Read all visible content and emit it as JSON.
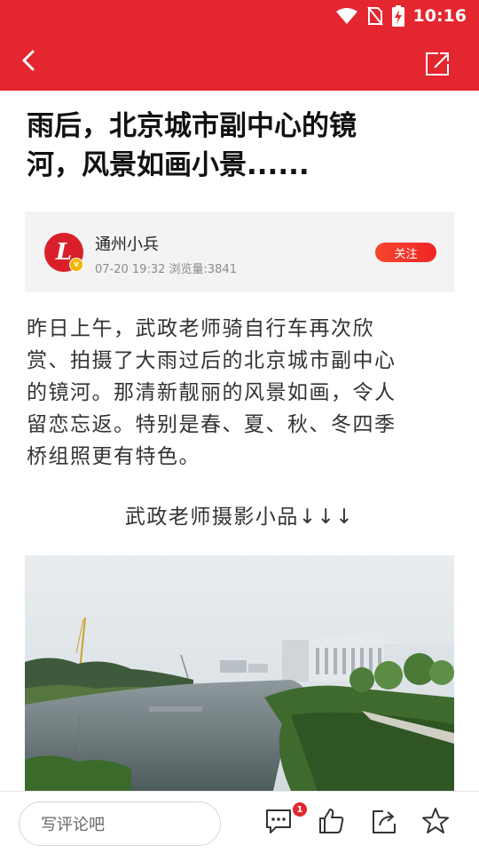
{
  "status_bar": {
    "time": "10:16"
  },
  "article": {
    "title_line1": "雨后，北京城市副中心的镜",
    "title_line2": "河，风景如画小景......",
    "body_lines": [
      "昨日上午，武政老师骑自行车再次欣",
      "赏、拍摄了大雨过后的北京城市副中心",
      "的镜河。那清新靓丽的风景如画，令人",
      "留恋忘返。特别是春、夏、秋、冬四季",
      "桥组照更有特色。"
    ],
    "caption": "武政老师摄影小品↓↓↓"
  },
  "author": {
    "avatar_letter": "L",
    "verified_letter": "v",
    "name": "通州小兵",
    "date": "07-20 19:32",
    "views_label": "浏览量:3841",
    "follow_label": "关注"
  },
  "bottom_bar": {
    "comment_placeholder": "写评论吧",
    "comment_count": "1"
  },
  "colors": {
    "brand_red": "#e3262f",
    "follow_orange": "#f5462e",
    "verified_yellow": "#f4b400"
  },
  "icons": [
    "wifi-icon",
    "no-sim-icon",
    "battery-charging-icon",
    "back-arrow-icon",
    "share-icon",
    "comment-icon",
    "like-icon",
    "forward-icon",
    "star-icon"
  ]
}
